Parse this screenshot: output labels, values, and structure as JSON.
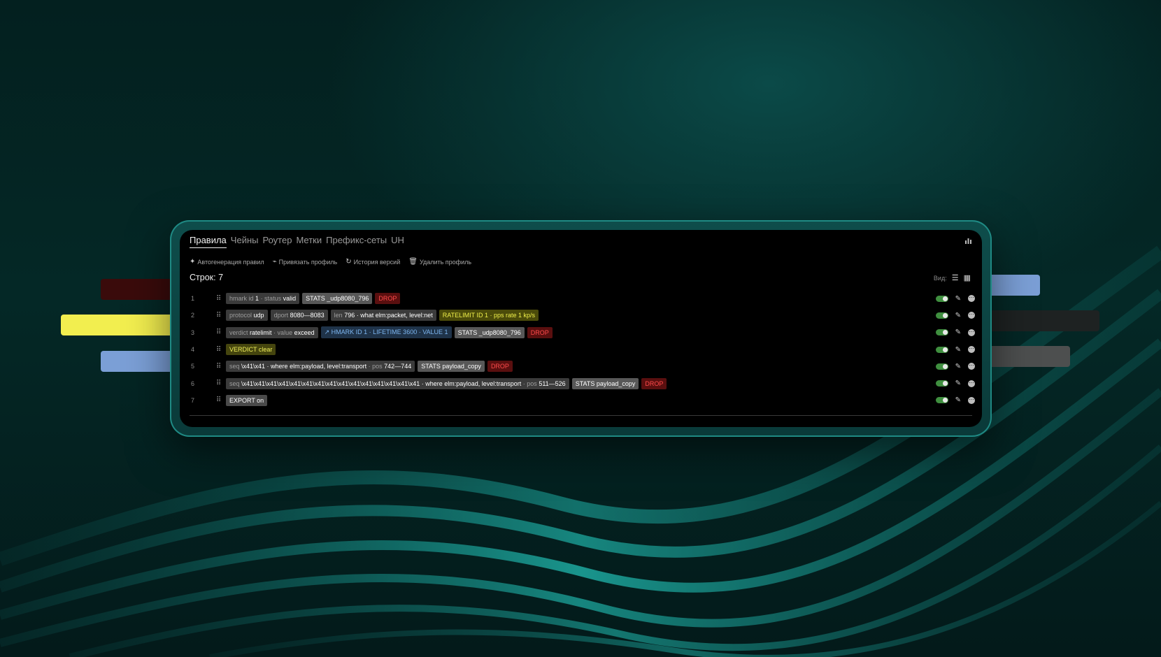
{
  "tabs": [
    {
      "label": "Правила",
      "active": true
    },
    {
      "label": "Чейны"
    },
    {
      "label": "Роутер"
    },
    {
      "label": "Метки"
    },
    {
      "label": "Префикс-сеты"
    },
    {
      "label": "UH"
    }
  ],
  "actions": [
    {
      "icon": "wand-icon",
      "label": "Автогенерация правил"
    },
    {
      "icon": "paperclip-icon",
      "label": "Привязать профиль"
    },
    {
      "icon": "history-icon",
      "label": "История версий"
    },
    {
      "icon": "trash-icon",
      "label": "Удалить профиль"
    }
  ],
  "row_count": "Строк: 7",
  "view_label": "Вид:",
  "rows": [
    {
      "num": "1",
      "chips": [
        {
          "type": "plain",
          "key1": "hmark id",
          "val1": "1",
          "key2": "· status",
          "val2": "valid"
        },
        {
          "type": "stats",
          "text": "STATS _udp8080_796"
        },
        {
          "type": "drop",
          "text": "DROP"
        }
      ]
    },
    {
      "num": "2",
      "chips": [
        {
          "type": "plain",
          "key1": "protocol",
          "val1": "udp"
        },
        {
          "type": "plain",
          "key1": "dport",
          "val1": "8080—8083"
        },
        {
          "type": "plain",
          "key1": "len",
          "val1": "796 · what elm:packet, level:net"
        },
        {
          "type": "rl",
          "text": "RATELIMIT ID 1 · pps rate 1 kp/s"
        }
      ]
    },
    {
      "num": "3",
      "chips": [
        {
          "type": "plain",
          "key1": "verdict",
          "val1": "ratelimit",
          "key2": "· value",
          "val2": "exceed"
        },
        {
          "type": "hmark",
          "text": "HMARK ID 1 · LIFETIME 3600 · VALUE 1"
        },
        {
          "type": "stats",
          "text": "STATS _udp8080_796"
        },
        {
          "type": "drop",
          "text": "DROP"
        }
      ]
    },
    {
      "num": "4",
      "chips": [
        {
          "type": "verdict",
          "text": "VERDICT clear"
        }
      ]
    },
    {
      "num": "5",
      "chips": [
        {
          "type": "plain",
          "key1": "seq",
          "val1": "\\x41\\x41 · where elm:payload, level:transport",
          "key2": "· pos",
          "val2": "742—744"
        },
        {
          "type": "stats",
          "text": "STATS payload_copy"
        },
        {
          "type": "drop",
          "text": "DROP"
        }
      ]
    },
    {
      "num": "6",
      "chips": [
        {
          "type": "plain",
          "key1": "seq",
          "val1": "\\x41\\x41\\x41\\x41\\x41\\x41\\x41\\x41\\x41\\x41\\x41\\x41\\x41\\x41\\x41 · where elm:payload, level:transport",
          "key2": "· pos",
          "val2": "511—526"
        },
        {
          "type": "stats",
          "text": "STATS payload_copy"
        },
        {
          "type": "drop",
          "text": "DROP"
        }
      ]
    },
    {
      "num": "7",
      "chips": [
        {
          "type": "export",
          "text": "EXPORT on"
        }
      ]
    }
  ],
  "colors": {
    "accent_teal": "#1f8a84",
    "drop_red": "#ff4b4b",
    "ratelimit_yellow": "#f0f04a",
    "hmark_blue": "#7db6f0",
    "toggle_green": "#3f8f3f",
    "deco_yellow": "#f2ee4f",
    "deco_blue": "#7b9fd6",
    "deco_darkred": "#3a0b0b"
  }
}
